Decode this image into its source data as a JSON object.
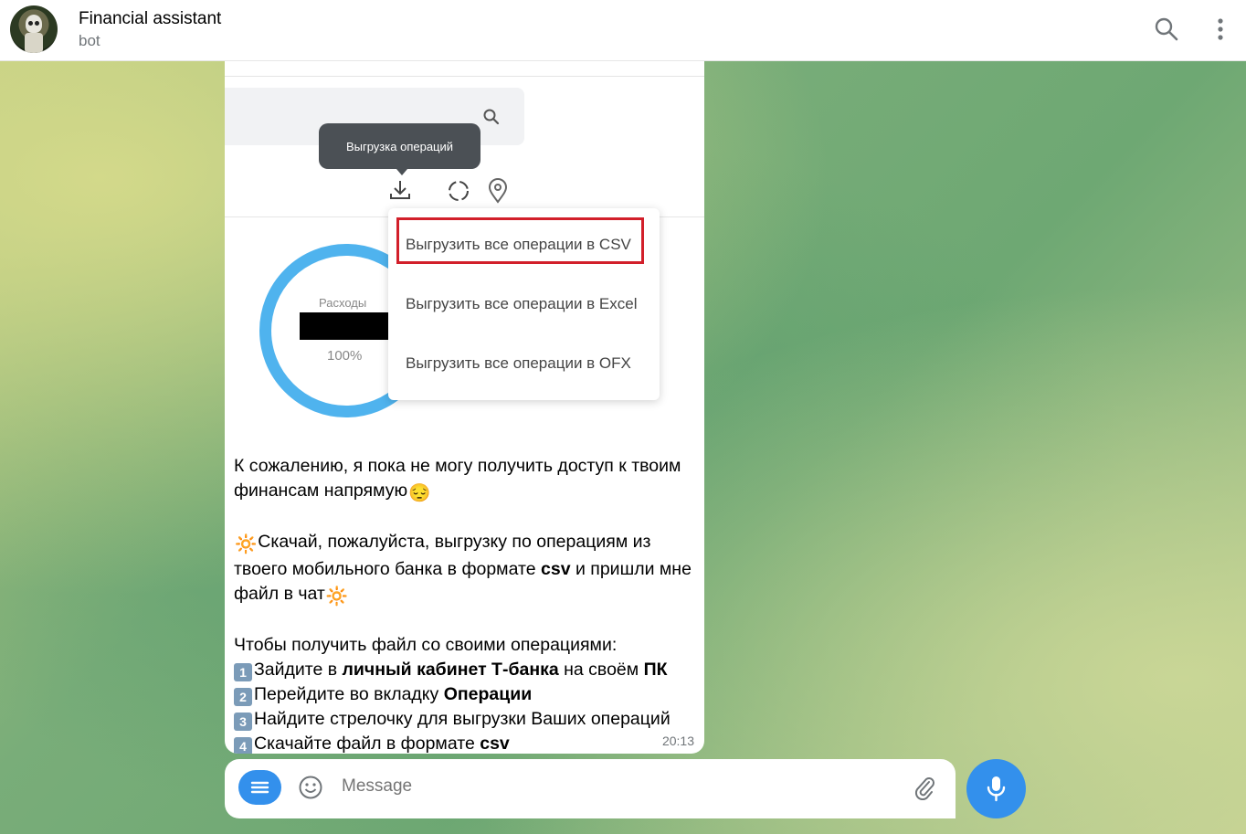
{
  "header": {
    "title": "Financial assistant",
    "subtitle": "bot",
    "search_icon": "search-icon",
    "more_icon": "more-vertical-icon"
  },
  "message": {
    "screenshot": {
      "tooltip": "Выгрузка операций",
      "donut_label": "Расходы",
      "donut_percent": "100%",
      "menu_items": [
        "Выгрузить все операции в CSV",
        "Выгрузить все операции в Excel",
        "Выгрузить все операции в OFX"
      ],
      "highlighted_item": "Выгрузить все операции в CSV",
      "highlight_color": "#d21f2a",
      "donut_color": "#4fb3ee"
    },
    "paragraph1": {
      "text": "К сожалению, я пока не могу получить доступ к твоим финансам напрямую",
      "emoji": "😔"
    },
    "paragraph2": {
      "emoji_start": "🔆",
      "part1": "Скачай, пожалуйста, выгрузку по операциям из твоего мобильного банка в формате ",
      "bold": "csv",
      "part2": " и пришли мне файл в чат",
      "emoji_end": "🔆"
    },
    "paragraph3": {
      "intro": "Чтобы получить файл со своими операциями:",
      "steps": [
        {
          "num": "1",
          "pre": "Зайдите в ",
          "bold": "личный кабинет Т-банка",
          "mid": " на своём ",
          "bold2": "ПК",
          "post": ""
        },
        {
          "num": "2",
          "pre": "Перейдите во вкладку ",
          "bold": "Операции",
          "mid": "",
          "bold2": "",
          "post": ""
        },
        {
          "num": "3",
          "pre": "Найдите стрелочку для выгрузки Ваших операций",
          "bold": "",
          "mid": "",
          "bold2": "",
          "post": ""
        },
        {
          "num": "4",
          "pre": "Скачайте файл в формате ",
          "bold": "csv",
          "mid": "",
          "bold2": "",
          "post": ""
        }
      ]
    },
    "time": "20:13"
  },
  "composer": {
    "placeholder": "Message",
    "accent": "#3390ec"
  }
}
